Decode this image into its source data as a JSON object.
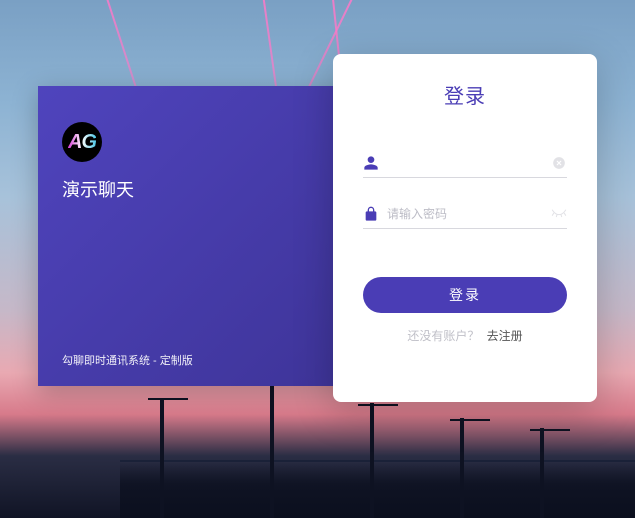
{
  "brand": {
    "logo_letters": "AG",
    "title": "演示聊天",
    "footer": "勾聊即时通讯系统 - 定制版"
  },
  "login": {
    "title": "登录",
    "username": {
      "value": "",
      "placeholder": ""
    },
    "password": {
      "value": "",
      "placeholder": "请输入密码"
    },
    "submit_label": "登录",
    "alt_prompt": "还没有账户？",
    "alt_link_label": "去注册"
  },
  "icons": {
    "user": "user-icon",
    "lock": "lock-icon",
    "clear": "clear-circle-icon",
    "eye_closed": "eye-closed-icon"
  },
  "colors": {
    "accent": "#4a3db5",
    "card_bg": "#ffffff"
  }
}
